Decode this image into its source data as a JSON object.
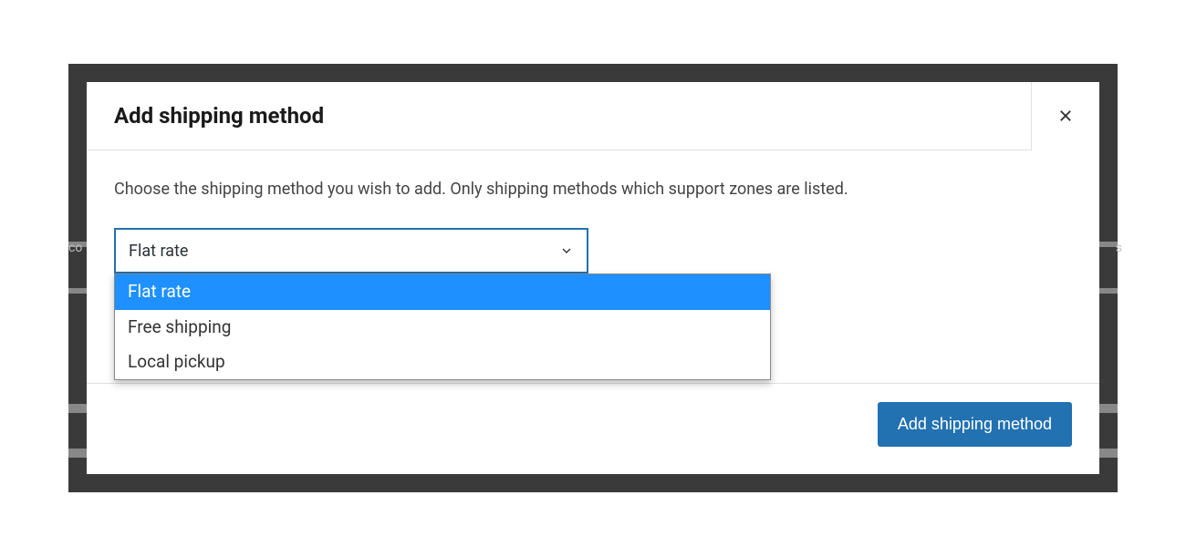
{
  "modal": {
    "title": "Add shipping method",
    "description": "Choose the shipping method you wish to add. Only shipping methods which support zones are listed.",
    "select": {
      "selected": "Flat rate",
      "options": [
        "Flat rate",
        "Free shipping",
        "Local pickup"
      ]
    },
    "submit_label": "Add shipping method"
  },
  "background": {
    "left_fragment": "co",
    "right_fragment": "s"
  }
}
